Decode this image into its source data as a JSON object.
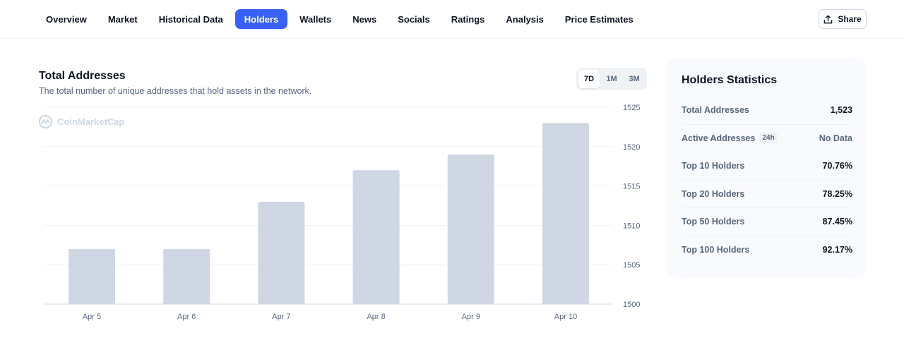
{
  "nav": {
    "tabs": [
      {
        "label": "Overview"
      },
      {
        "label": "Market"
      },
      {
        "label": "Historical Data"
      },
      {
        "label": "Holders"
      },
      {
        "label": "Wallets"
      },
      {
        "label": "News"
      },
      {
        "label": "Socials"
      },
      {
        "label": "Ratings"
      },
      {
        "label": "Analysis"
      },
      {
        "label": "Price Estimates"
      }
    ],
    "active_tab": "Holders",
    "share_label": "Share"
  },
  "chart_section": {
    "title": "Total Addresses",
    "subtitle": "The total number of unique addresses that hold assets in the network.",
    "watermark": "CoinMarketCap",
    "ranges": [
      "7D",
      "1M",
      "3M"
    ],
    "active_range": "7D"
  },
  "chart_data": {
    "type": "bar",
    "title": "Total Addresses",
    "categories": [
      "Apr 5",
      "Apr 6",
      "Apr 7",
      "Apr 8",
      "Apr 9",
      "Apr 10"
    ],
    "values": [
      1507,
      1507,
      1513,
      1517,
      1519,
      1523
    ],
    "ylim": [
      1500,
      1525
    ],
    "yticks": [
      1525,
      1520,
      1515,
      1510,
      1505,
      1500
    ],
    "y_axis_side": "right",
    "grid": true,
    "bar_color": "#cfd6e4"
  },
  "stats": {
    "title": "Holders Statistics",
    "rows": [
      {
        "label": "Total Addresses",
        "value": "1,523"
      },
      {
        "label": "Active Addresses",
        "badge": "24h",
        "value": "No Data"
      },
      {
        "label": "Top 10 Holders",
        "value": "70.76%"
      },
      {
        "label": "Top 20 Holders",
        "value": "78.25%"
      },
      {
        "label": "Top 50 Holders",
        "value": "87.45%"
      },
      {
        "label": "Top 100 Holders",
        "value": "92.17%"
      }
    ]
  },
  "colors": {
    "accent": "#3861fb",
    "text": "#0d1421",
    "muted": "#58667e",
    "bar": "#cfd6e4"
  },
  "icons": {
    "share": "share-icon",
    "watermark_logo": "coinmarketcap-logo-icon"
  }
}
